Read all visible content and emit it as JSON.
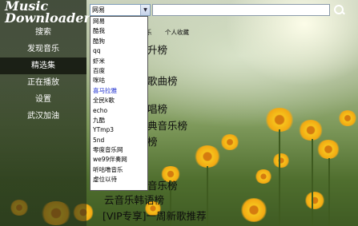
{
  "app": {
    "title_line1": "Music",
    "title_line2": "Downloader"
  },
  "sidebar": {
    "items": [
      {
        "label": "搜索"
      },
      {
        "label": "发现音乐"
      },
      {
        "label": "精选集",
        "active": true
      },
      {
        "label": "正在播放"
      },
      {
        "label": "设置"
      },
      {
        "label": "武汉加油"
      }
    ]
  },
  "search": {
    "source_selected": "网易",
    "query": ""
  },
  "tabs": [
    "乐",
    "个人收藏"
  ],
  "playlists": [
    "升榜",
    "歌曲榜",
    "唱榜",
    "典音乐榜",
    "榜",
    "音乐榜",
    "云音乐韩语榜",
    "[VIP专享]一周新歌推荐"
  ],
  "dropdown": {
    "options": [
      "网易",
      "酷我",
      "酷狗",
      "qq",
      "虾米",
      "百度",
      "咪咕",
      "喜马拉雅",
      "全民k歌",
      "echo",
      "九酷",
      "YTmp3",
      "5nd",
      "零度音乐网",
      "we99伴奏网",
      "听咕噜音乐",
      "虚位以待"
    ],
    "highlighted": "喜马拉雅"
  },
  "colors": {
    "dropdown_highlight": "#1f30d0",
    "sidebar_active": "#0b1008"
  },
  "icons": {
    "search_button": "search-icon",
    "select_arrow": "chevron-down-icon"
  }
}
